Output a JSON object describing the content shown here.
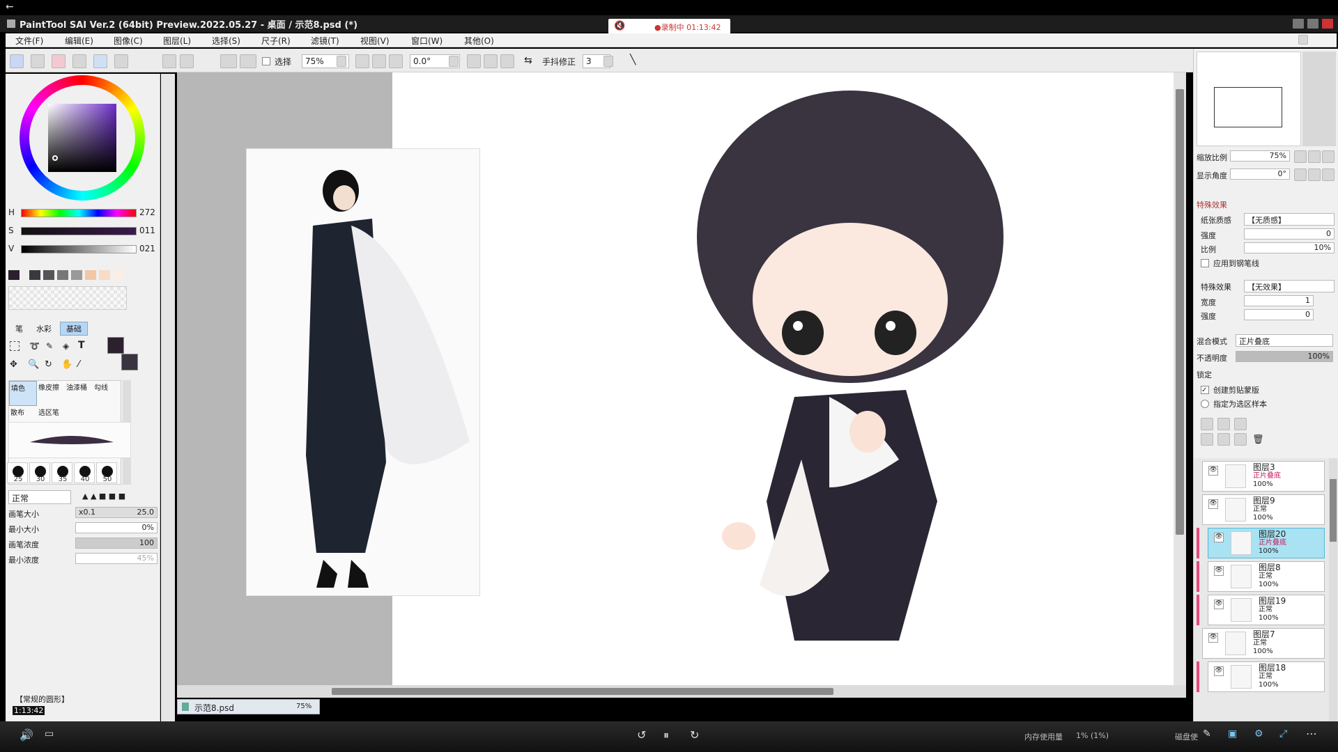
{
  "titlebar": {
    "title": "PaintTool SAI Ver.2 (64bit) Preview.2022.05.27 - 桌面 / 示范8.psd (*)"
  },
  "recording": {
    "text": "●录制中 01:13:42"
  },
  "menu": [
    "文件(F)",
    "编辑(E)",
    "图像(C)",
    "图层(L)",
    "选择(S)",
    "尺子(R)",
    "滤镜(T)",
    "视图(V)",
    "窗口(W)",
    "其他(O)"
  ],
  "toolbar": {
    "select_label": "选择",
    "zoom": "75%",
    "angle": "0.0°",
    "stabilizer_label": "手抖修正",
    "stabilizer_value": "3"
  },
  "color": {
    "h_label": "H",
    "h_value": "272",
    "s_label": "S",
    "s_value": "011",
    "v_label": "V",
    "v_value": "021"
  },
  "tool_tabs": [
    "笔",
    "水彩",
    "基础"
  ],
  "brush_tools": [
    "填色",
    "橡皮擦",
    "油漆桶",
    "勾线",
    "散布",
    "选区笔"
  ],
  "brush_sizes": [
    "25",
    "30",
    "35",
    "40",
    "50"
  ],
  "brush_settings": {
    "blend_mode": "正常",
    "size_label": "画笔大小",
    "size_mult": "x0.1",
    "size_value": "25.0",
    "min_size_label": "最小大小",
    "min_size_value": "0%",
    "density_label": "画笔浓度",
    "density_value": "100",
    "min_density_label": "最小浓度",
    "min_density_value": "45%",
    "texture_label": "【常规的圆形】"
  },
  "time_small": "1:13:42",
  "file_tab": {
    "name": "示范8.psd",
    "zoom": "75%"
  },
  "navigator": {
    "zoom_label": "缩放比例",
    "zoom_value": "75%",
    "angle_label": "显示角度",
    "angle_value": "0°"
  },
  "effects": {
    "section_label": "特殊效果",
    "paper_label": "纸张质感",
    "paper_value": "【无质感】",
    "strength_label": "强度",
    "strength_value": "0",
    "scale_label": "比例",
    "scale_value": "10%",
    "apply_pen_label": "应用到钢笔线",
    "effect_label": "特殊效果",
    "effect_value": "【无效果】",
    "width_label": "宽度",
    "width_value": "1",
    "strength2_label": "强度",
    "strength2_value": "0"
  },
  "layer_props": {
    "blend_label": "混合模式",
    "blend_value": "正片叠底",
    "opacity_label": "不透明度",
    "opacity_value": "100%",
    "lock_label": "锁定",
    "clip_label": "创建剪贴蒙版",
    "sample_label": "指定为选区样本"
  },
  "layers": [
    {
      "name": "图层3",
      "mode": "正片叠底",
      "opacity": "100%"
    },
    {
      "name": "图层9",
      "mode": "正常",
      "opacity": "100%"
    },
    {
      "name": "图层20",
      "mode": "正片叠底",
      "opacity": "100%"
    },
    {
      "name": "图层8",
      "mode": "正常",
      "opacity": "100%"
    },
    {
      "name": "图层19",
      "mode": "正常",
      "opacity": "100%"
    },
    {
      "name": "图层7",
      "mode": "正常",
      "opacity": "100%"
    },
    {
      "name": "图层18",
      "mode": "正常",
      "opacity": "100%"
    }
  ],
  "status": {
    "mem_label": "内存使用量",
    "mem_value": "1% (1%)",
    "disk_label": "磁盘使"
  },
  "colors": {
    "accent": "#a9e2f2",
    "pink": "#e44a7b",
    "fg": "#2c1f2e"
  }
}
